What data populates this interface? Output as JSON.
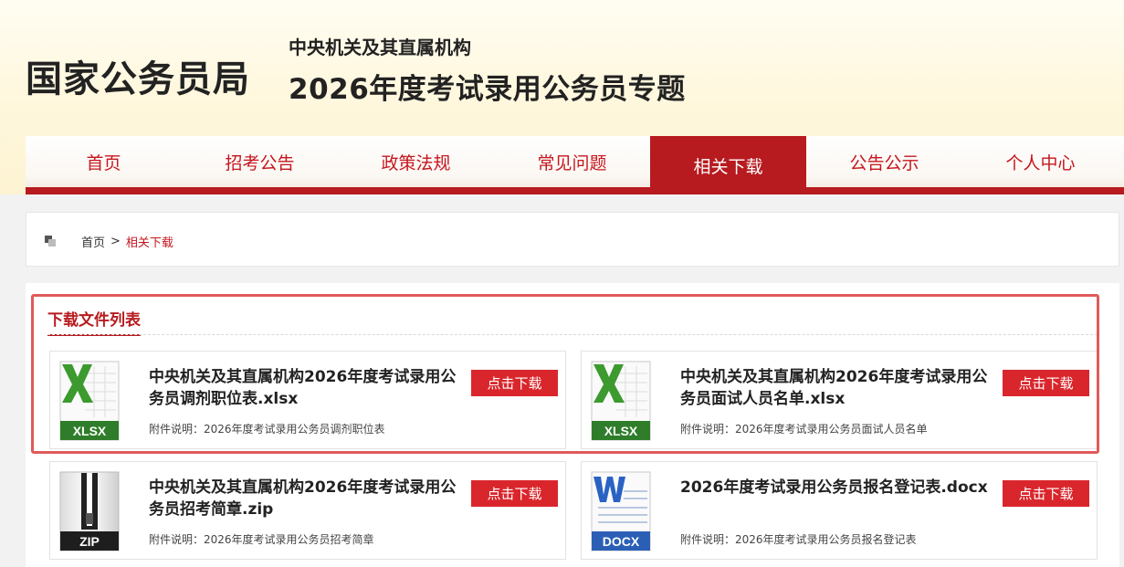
{
  "header": {
    "logo": "国家公务员局",
    "subtitle_line1": "中央机关及其直属机构",
    "subtitle_line2": "2026年度考试录用公务员专题"
  },
  "nav": {
    "items": [
      {
        "label": "首页",
        "active": false
      },
      {
        "label": "招考公告",
        "active": false
      },
      {
        "label": "政策法规",
        "active": false
      },
      {
        "label": "常见问题",
        "active": false
      },
      {
        "label": "相关下载",
        "active": true
      },
      {
        "label": "公告公示",
        "active": false
      },
      {
        "label": "个人中心",
        "active": false
      }
    ]
  },
  "breadcrumb": {
    "home": "首页",
    "separator": ">",
    "current": "相关下载"
  },
  "download_list": {
    "title": "下载文件列表",
    "files": [
      {
        "icon": "xlsx-file-icon",
        "badge": "XLSX",
        "title": "中央机关及其直属机构2026年度考试录用公务员调剂职位表.xlsx",
        "desc": "附件说明：2026年度考试录用公务员调剂职位表",
        "button": "点击下载"
      },
      {
        "icon": "xlsx-file-icon",
        "badge": "XLSX",
        "title": "中央机关及其直属机构2026年度考试录用公务员面试人员名单.xlsx",
        "desc": "附件说明：2026年度考试录用公务员面试人员名单",
        "button": "点击下载"
      },
      {
        "icon": "zip-file-icon",
        "badge": "ZIP",
        "title": "中央机关及其直属机构2026年度考试录用公务员招考简章.zip",
        "desc": "附件说明：2026年度考试录用公务员招考简章",
        "button": "点击下载"
      },
      {
        "icon": "docx-file-icon",
        "badge": "DOCX",
        "title": "2026年度考试录用公务员报名登记表.docx",
        "desc": "附件说明：2026年度考试录用公务员报名登记表",
        "button": "点击下载"
      }
    ]
  },
  "colors": {
    "brand_red": "#b71b1f",
    "button_red": "#d9262c",
    "highlight_border": "#e05a5a",
    "excel_green": "#2f8a2f",
    "word_blue": "#2a62c4"
  }
}
